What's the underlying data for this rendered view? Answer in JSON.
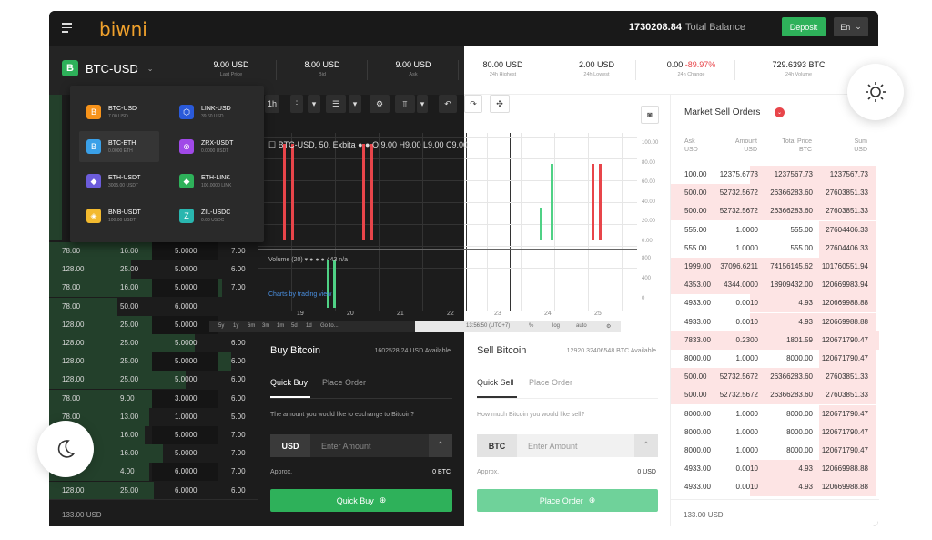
{
  "header": {
    "logo": "biwni",
    "balance_value": "1730208.84",
    "balance_label": "Total Balance",
    "deposit": "Deposit",
    "lang": "En"
  },
  "pair": {
    "icon": "B",
    "name": "BTC-USD"
  },
  "stats": [
    {
      "value": "9.00 USD",
      "label": "Last Price"
    },
    {
      "value": "8.00 USD",
      "label": "Bid"
    },
    {
      "value": "9.00 USD",
      "label": "Ask"
    },
    {
      "value": "80.00 USD",
      "label": "24h Highest"
    },
    {
      "value": "2.00 USD",
      "label": "24h Lowest"
    },
    {
      "value": "0.00",
      "value2": "-89.97%",
      "label": "24h Change"
    },
    {
      "value": "729.6393 BTC",
      "label": "24h Volume"
    }
  ],
  "dropdown": [
    {
      "name": "BTC-USD",
      "sub": "7.00 USD",
      "color": "#f7931a",
      "glyph": "B"
    },
    {
      "name": "LINK-USD",
      "sub": "39.60 USD",
      "color": "#2a5ada",
      "glyph": "⬡"
    },
    {
      "name": "BTC-ETH",
      "sub": "0.0000 ETH",
      "color": "#3aa0e8",
      "glyph": "B"
    },
    {
      "name": "ZRX-USDT",
      "sub": "0.0000 USDT",
      "color": "#a049e8",
      "glyph": "⊗"
    },
    {
      "name": "ETH-USDT",
      "sub": "3005.00 USDT",
      "color": "#6c5cdb",
      "glyph": "◆"
    },
    {
      "name": "ETH-LINK",
      "sub": "100.0000 LINK",
      "color": "#2eb15a",
      "glyph": "◆"
    },
    {
      "name": "BNB-USDT",
      "sub": "100.00 USDT",
      "color": "#f3ba2f",
      "glyph": "◈"
    },
    {
      "name": "ZIL-USDC",
      "sub": "0.00 USDC",
      "color": "#29b6af",
      "glyph": "Z"
    }
  ],
  "left_orderbook": {
    "rows": [
      [
        "78.00",
        "16.00",
        "5.0000",
        "7.00"
      ],
      [
        "128.00",
        "25.00",
        "5.0000",
        "6.00"
      ],
      [
        "78.00",
        "16.00",
        "5.0000",
        "7.00"
      ],
      [
        "78.00",
        "50.00",
        "6.0000",
        ""
      ],
      [
        "128.00",
        "25.00",
        "5.0000",
        "6.00"
      ],
      [
        "128.00",
        "25.00",
        "5.0000",
        "6.00"
      ],
      [
        "128.00",
        "25.00",
        "5.0000",
        "6.00"
      ],
      [
        "128.00",
        "25.00",
        "5.0000",
        "6.00"
      ],
      [
        "78.00",
        "9.00",
        "3.0000",
        "6.00"
      ],
      [
        "78.00",
        "13.00",
        "1.0000",
        "5.00"
      ],
      [
        "78.00",
        "16.00",
        "5.0000",
        "7.00"
      ],
      [
        "78.00",
        "16.00",
        "5.0000",
        "7.00"
      ],
      [
        "78.00",
        "4.00",
        "6.0000",
        "7.00"
      ],
      [
        "128.00",
        "25.00",
        "6.0000",
        "6.00"
      ]
    ],
    "footer": "133.00 USD"
  },
  "chart": {
    "interval": "1h",
    "legend": "BTC-USD, 50, Exbita",
    "ohlc": "O 9.00  H9.00  L9.00  C9.00",
    "volume": "Volume (20)",
    "vol_val": "443  n/a",
    "link": "Charts by trading view",
    "x_dark": [
      "19",
      "20",
      "21",
      "22"
    ],
    "x_light": [
      "23",
      "24",
      "25"
    ],
    "y": [
      "100.00",
      "80.00",
      "60.00",
      "40.00",
      "20.00",
      "0.00"
    ],
    "y_vol": [
      "800",
      "400",
      "0"
    ],
    "timeframes": [
      "5y",
      "1y",
      "6m",
      "3m",
      "1m",
      "5d",
      "1d",
      "Go to..."
    ],
    "utc": "13:56:50 (UTC+7)",
    "opts": [
      "%",
      "log",
      "auto"
    ]
  },
  "buy": {
    "title": "Buy Bitcoin",
    "available": "1602528.24 USD Available",
    "tab1": "Quick Buy",
    "tab2": "Place Order",
    "prompt": "The amount you would like to exchange to Bitcoin?",
    "currency": "USD",
    "placeholder": "Enter Amount",
    "approx": "Approx.",
    "approx_val": "0 BTC",
    "button": "Quick Buy"
  },
  "sell": {
    "title": "Sell Bitcoin",
    "available": "12920.32406548 BTC Available",
    "tab1": "Quick Sell",
    "tab2": "Place Order",
    "prompt": "How much Bitcoin you would like sell?",
    "currency": "BTC",
    "placeholder": "Enter Amount",
    "approx": "Approx.",
    "approx_val": "0 USD",
    "button": "Place Order"
  },
  "right_orderbook": {
    "title": "Market Sell Orders",
    "cols": [
      [
        "Ask",
        "USD"
      ],
      [
        "Amount",
        "USD"
      ],
      [
        "Total Price",
        "BTC"
      ],
      [
        "Sum",
        "USD"
      ]
    ],
    "rows": [
      [
        "100.00",
        "12375.6773",
        "1237567.73",
        "1237567.73"
      ],
      [
        "500.00",
        "52732.5672",
        "26366283.60",
        "27603851.33"
      ],
      [
        "500.00",
        "52732.5672",
        "26366283.60",
        "27603851.33"
      ],
      [
        "555.00",
        "1.0000",
        "555.00",
        "27604406.33"
      ],
      [
        "555.00",
        "1.0000",
        "555.00",
        "27604406.33"
      ],
      [
        "1999.00",
        "37096.6211",
        "74156145.62",
        "101760551.94"
      ],
      [
        "4353.00",
        "4344.0000",
        "18909432.00",
        "120669983.94"
      ],
      [
        "4933.00",
        "0.0010",
        "4.93",
        "120669988.88"
      ],
      [
        "4933.00",
        "0.0010",
        "4.93",
        "120669988.88"
      ],
      [
        "7833.00",
        "0.2300",
        "1801.59",
        "120671790.47"
      ],
      [
        "8000.00",
        "1.0000",
        "8000.00",
        "120671790.47"
      ],
      [
        "500.00",
        "52732.5672",
        "26366283.60",
        "27603851.33"
      ],
      [
        "500.00",
        "52732.5672",
        "26366283.60",
        "27603851.33"
      ],
      [
        "8000.00",
        "1.0000",
        "8000.00",
        "120671790.47"
      ],
      [
        "8000.00",
        "1.0000",
        "8000.00",
        "120671790.47"
      ],
      [
        "8000.00",
        "1.0000",
        "8000.00",
        "120671790.47"
      ],
      [
        "4933.00",
        "0.0010",
        "4.93",
        "120669988.88"
      ],
      [
        "4933.00",
        "0.0010",
        "4.93",
        "120669988.88"
      ]
    ],
    "footer": "133.00 USD"
  }
}
